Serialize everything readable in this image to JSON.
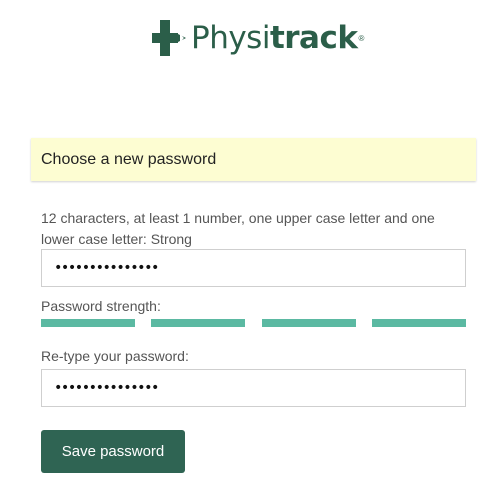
{
  "brand": {
    "name_light": "Physi",
    "name_bold": "track",
    "registered": "®",
    "color": "#2b5e49"
  },
  "notice": {
    "title": "Choose a new password",
    "background": "#fdfdd2"
  },
  "password": {
    "hint": "12 characters, at least 1 number, one upper case letter and one lower case letter: Strong",
    "value_masked": "•••••••••••••••",
    "strength_label": "Password strength:",
    "strength_level": 4,
    "strength_max": 4,
    "strength_color": "#5bb9a2",
    "retype_label": "Re-type your password:",
    "retype_value_masked": "•••••••••••••••"
  },
  "actions": {
    "save_label": "Save password",
    "save_color": "#2f6453"
  }
}
